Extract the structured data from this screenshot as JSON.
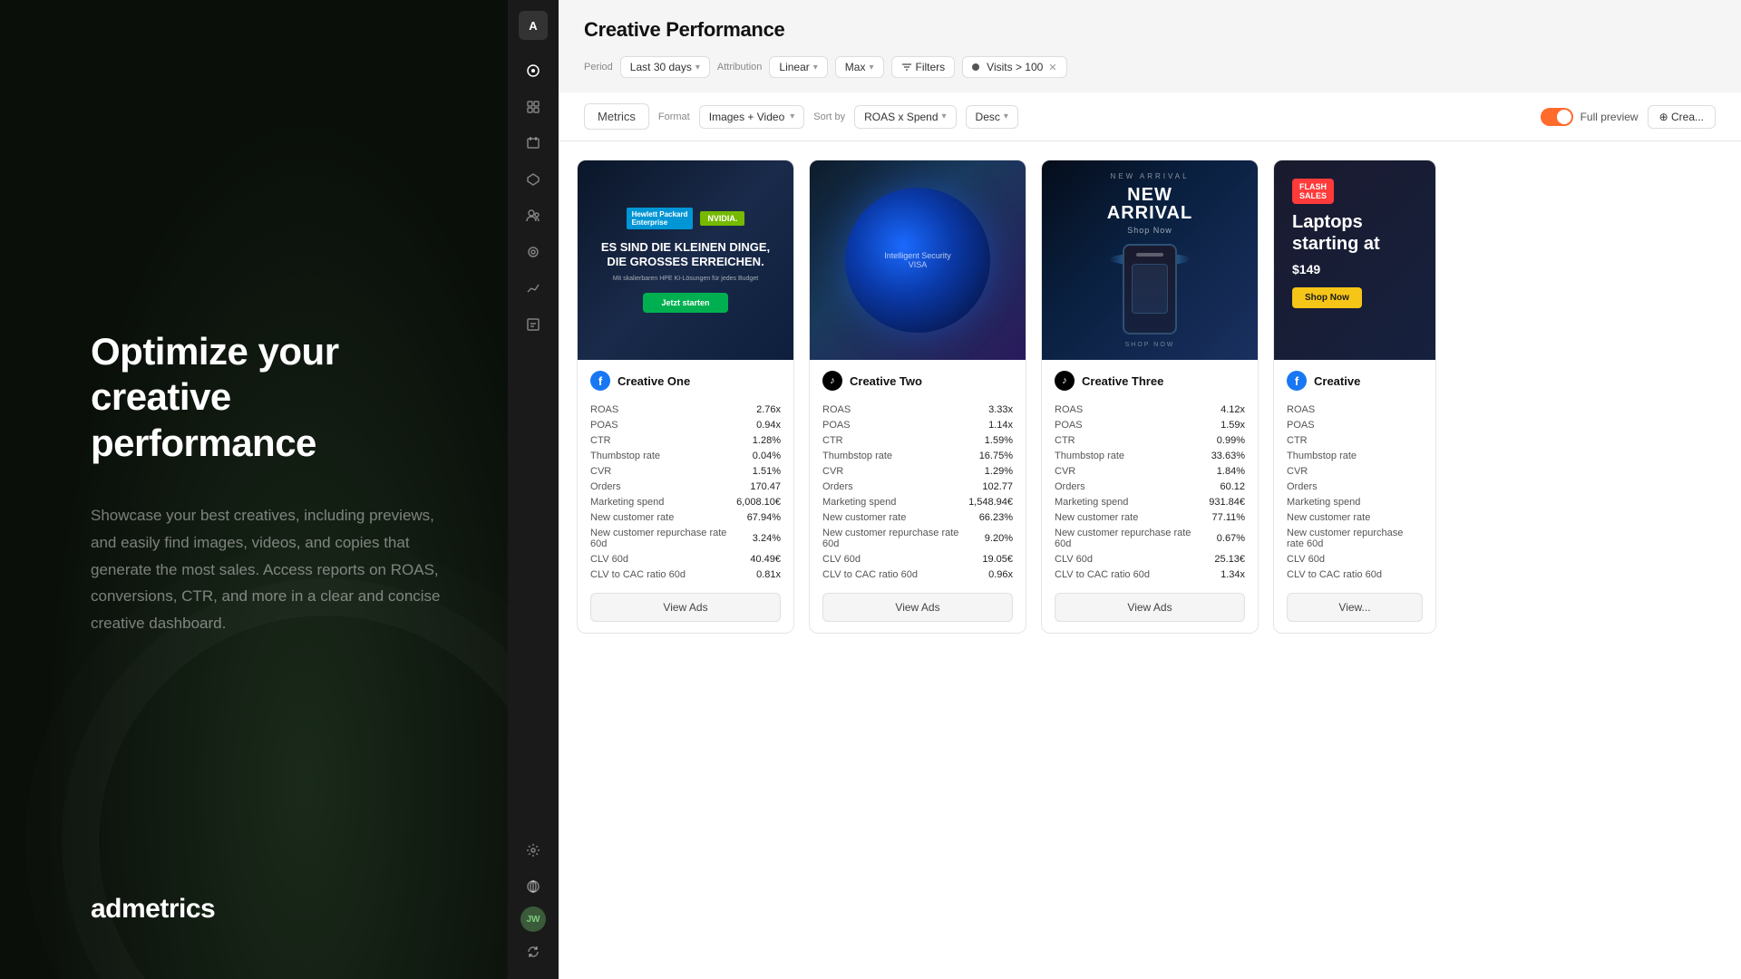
{
  "left": {
    "headline": "Optimize your creative performance",
    "description": "Showcase your best creatives, including previews, and easily find images, videos, and copies that generate the most sales. Access reports on ROAS, conversions, CTR, and more in a clear and concise creative dashboard.",
    "brand": "admetrics"
  },
  "app": {
    "title": "Creative Performance",
    "filters": {
      "period_label": "Period",
      "period_value": "Last 30 days",
      "attribution_label": "Attribution",
      "attribution_value": "Linear",
      "max_value": "Max",
      "filters_label": "Filters",
      "visits_label": "Visits > 100"
    },
    "toolbar": {
      "metrics_tab": "Metrics",
      "format_label": "Format",
      "format_value": "Images + Video",
      "sort_label": "Sort by",
      "sort_value": "ROAS x Spend",
      "desc_value": "Desc",
      "full_preview_label": "Full preview",
      "cr_label": "⊕ Crea..."
    },
    "creatives": [
      {
        "id": "creative-one",
        "name": "Creative One",
        "icon_type": "meta",
        "icon_label": "f",
        "image_type": "nvidia",
        "metrics": [
          {
            "label": "ROAS",
            "value": "2.76x"
          },
          {
            "label": "POAS",
            "value": "0.94x"
          },
          {
            "label": "CTR",
            "value": "1.28%"
          },
          {
            "label": "Thumbstop rate",
            "value": "0.04%"
          },
          {
            "label": "CVR",
            "value": "1.51%"
          },
          {
            "label": "Orders",
            "value": "170.47"
          },
          {
            "label": "Marketing spend",
            "value": "6,008.10€"
          },
          {
            "label": "New customer rate",
            "value": "67.94%"
          },
          {
            "label": "New customer repurchase rate 60d",
            "value": "3.24%"
          },
          {
            "label": "CLV 60d",
            "value": "40.49€"
          },
          {
            "label": "CLV to CAC ratio 60d",
            "value": "0.81x"
          }
        ]
      },
      {
        "id": "creative-two",
        "name": "Creative Two",
        "icon_type": "tiktok",
        "icon_label": "♪",
        "image_type": "cyber",
        "metrics": [
          {
            "label": "ROAS",
            "value": "3.33x"
          },
          {
            "label": "POAS",
            "value": "1.14x"
          },
          {
            "label": "CTR",
            "value": "1.59%"
          },
          {
            "label": "Thumbstop rate",
            "value": "16.75%"
          },
          {
            "label": "CVR",
            "value": "1.29%"
          },
          {
            "label": "Orders",
            "value": "102.77"
          },
          {
            "label": "Marketing spend",
            "value": "1,548.94€"
          },
          {
            "label": "New customer rate",
            "value": "66.23%"
          },
          {
            "label": "New customer repurchase rate 60d",
            "value": "9.20%"
          },
          {
            "label": "CLV 60d",
            "value": "19.05€"
          },
          {
            "label": "CLV to CAC ratio 60d",
            "value": "0.96x"
          }
        ]
      },
      {
        "id": "creative-three",
        "name": "Creative Three",
        "icon_type": "tiktok",
        "icon_label": "♪",
        "image_type": "phone",
        "metrics": [
          {
            "label": "ROAS",
            "value": "4.12x"
          },
          {
            "label": "POAS",
            "value": "1.59x"
          },
          {
            "label": "CTR",
            "value": "0.99%"
          },
          {
            "label": "Thumbstop rate",
            "value": "33.63%"
          },
          {
            "label": "CVR",
            "value": "1.84%"
          },
          {
            "label": "Orders",
            "value": "60.12"
          },
          {
            "label": "Marketing spend",
            "value": "931.84€"
          },
          {
            "label": "New customer rate",
            "value": "77.11%"
          },
          {
            "label": "New customer repurchase rate 60d",
            "value": "0.67%"
          },
          {
            "label": "CLV 60d",
            "value": "25.13€"
          },
          {
            "label": "CLV to CAC ratio 60d",
            "value": "1.34x"
          }
        ]
      },
      {
        "id": "creative-four",
        "name": "Creative",
        "icon_type": "meta",
        "icon_label": "f",
        "image_type": "flash",
        "metrics": [
          {
            "label": "ROAS",
            "value": ""
          },
          {
            "label": "POAS",
            "value": ""
          },
          {
            "label": "CTR",
            "value": ""
          },
          {
            "label": "Thumbstop rate",
            "value": ""
          },
          {
            "label": "CVR",
            "value": ""
          },
          {
            "label": "Orders",
            "value": ""
          },
          {
            "label": "Marketing spend",
            "value": ""
          },
          {
            "label": "New customer rate",
            "value": ""
          },
          {
            "label": "New customer repurchase rate 60d",
            "value": ""
          },
          {
            "label": "CLV 60d",
            "value": ""
          },
          {
            "label": "CLV to CAC ratio 60d",
            "value": ""
          }
        ]
      }
    ],
    "sidebar_icons": [
      "≫",
      "◉",
      "◈",
      "▣",
      "◆",
      "⊕",
      "⇌",
      "⋮"
    ],
    "view_ads_label": "View Ads"
  }
}
